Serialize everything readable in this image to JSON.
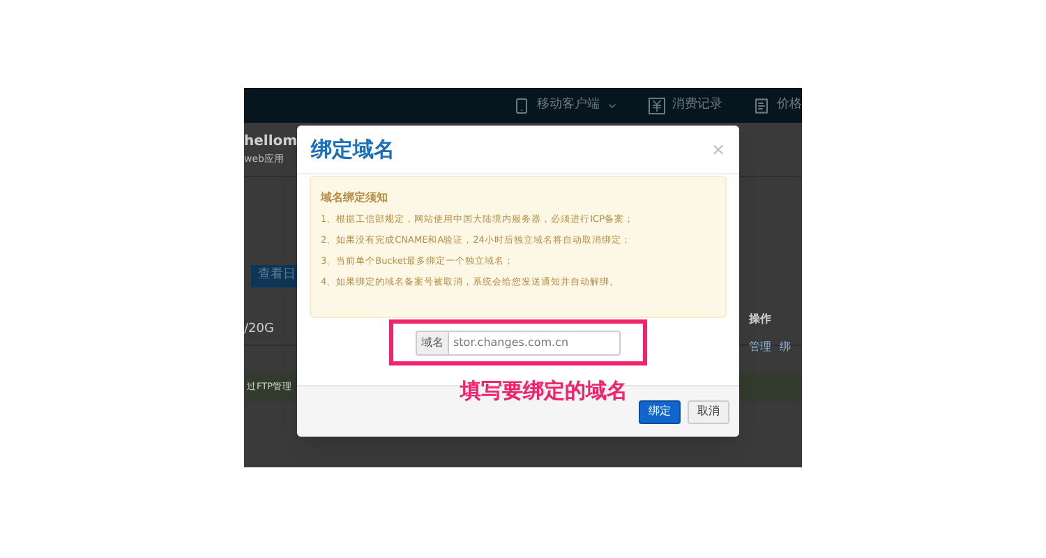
{
  "app_nav": {
    "items": [
      {
        "label": "移动客户端",
        "kind": "phone"
      },
      {
        "label": "消费记录",
        "kind": "yen"
      },
      {
        "label": "价格",
        "kind": "list"
      }
    ]
  },
  "app_page": {
    "title": "hellom",
    "subtitle": "web应用",
    "action_button": "查看日",
    "storage_reading": "/20G",
    "operations_header": "操作",
    "manage_link": "管理",
    "bind_link": "绑",
    "ftp_banner": "过FTP管理"
  },
  "dialog": {
    "title": "绑定域名",
    "close": "×",
    "notice": {
      "heading": "域名绑定须知",
      "items": [
        "1、根据工信部规定，网站使用中国大陆境内服务器，必须进行ICP备案；",
        "2、如果没有完成CNAME和A验证，24小时后独立域名将自动取消绑定；",
        "3、当前单个Bucket最多绑定一个独立域名；",
        "4、如果绑定的域名备案号被取消，系统会给您发送通知并自动解绑。"
      ]
    },
    "domain_field": {
      "label": "域名",
      "value": "stor.changes.com.cn"
    },
    "annotation": "填写要绑定的域名",
    "buttons": [
      {
        "label": "绑定",
        "kind": "primary"
      },
      {
        "label": "取消",
        "kind": "default"
      }
    ]
  }
}
